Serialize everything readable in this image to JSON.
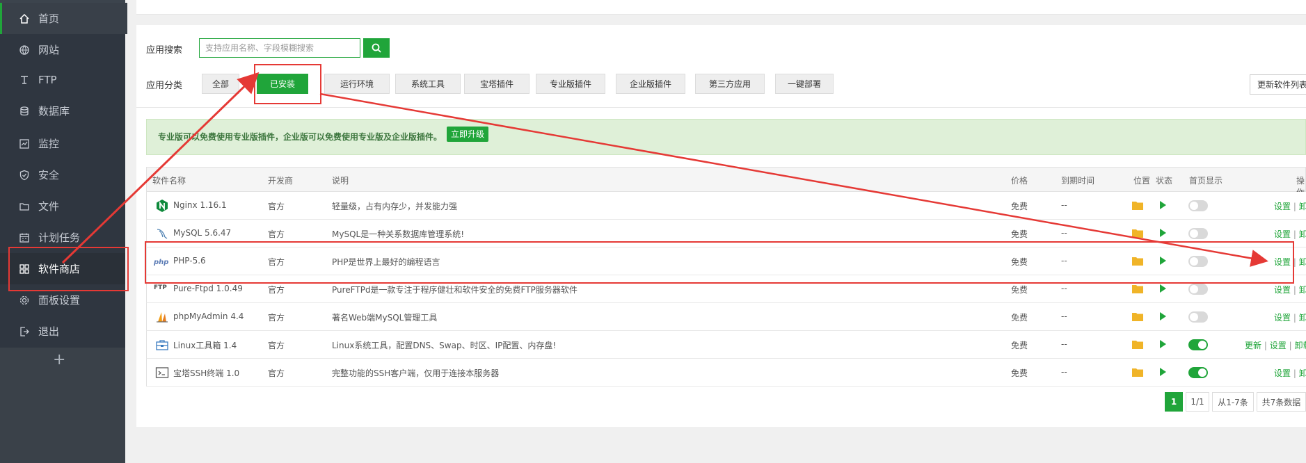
{
  "sidebar": {
    "items": [
      {
        "label": "首页",
        "icon": "home-icon"
      },
      {
        "label": "网站",
        "icon": "globe-icon"
      },
      {
        "label": "FTP",
        "icon": "ftp-icon"
      },
      {
        "label": "数据库",
        "icon": "database-icon"
      },
      {
        "label": "监控",
        "icon": "monitor-icon"
      },
      {
        "label": "安全",
        "icon": "shield-icon"
      },
      {
        "label": "文件",
        "icon": "folder-icon"
      },
      {
        "label": "计划任务",
        "icon": "calendar-icon"
      },
      {
        "label": "软件商店",
        "icon": "grid-icon"
      },
      {
        "label": "面板设置",
        "icon": "gear-icon"
      },
      {
        "label": "退出",
        "icon": "exit-icon"
      }
    ],
    "add_label": "+"
  },
  "search": {
    "label": "应用搜索",
    "placeholder": "支持应用名称、字段模糊搜索"
  },
  "categories": {
    "label": "应用分类",
    "items": [
      "全部",
      "已安装",
      "运行环境",
      "系统工具",
      "宝塔插件",
      "专业版插件",
      "企业版插件",
      "第三方应用",
      "一键部署"
    ],
    "active": "已安装"
  },
  "update_list_label": "更新软件列表",
  "notice": {
    "text": "专业版可以免费使用专业版插件，企业版可以免费使用专业版及企业版插件。",
    "button": "立即升级"
  },
  "table": {
    "headers": {
      "name": "软件名称",
      "dev": "开发商",
      "desc": "说明",
      "price": "价格",
      "expire": "到期时间",
      "location": "位置",
      "status": "状态",
      "home_display": "首页显示",
      "ops": "操作"
    },
    "rows": [
      {
        "name": "Nginx 1.16.1",
        "dev": "官方",
        "desc": "轻量级，占有内存少，并发能力强",
        "price": "免费",
        "expire": "--",
        "home": false,
        "ops": [
          "设置",
          "卸载"
        ],
        "icon": "nginx-icon"
      },
      {
        "name": "MySQL 5.6.47",
        "dev": "官方",
        "desc": "MySQL是一种关系数据库管理系统!",
        "price": "免费",
        "expire": "--",
        "home": false,
        "ops": [
          "设置",
          "卸载"
        ],
        "icon": "mysql-icon"
      },
      {
        "name": "PHP-5.6",
        "dev": "官方",
        "desc": "PHP是世界上最好的编程语言",
        "price": "免费",
        "expire": "--",
        "home": false,
        "ops": [
          "设置",
          "卸载"
        ],
        "icon": "php-icon"
      },
      {
        "name": "Pure-Ftpd 1.0.49",
        "dev": "官方",
        "desc": "PureFTPd是一款专注于程序健壮和软件安全的免费FTP服务器软件",
        "price": "免费",
        "expire": "--",
        "home": false,
        "ops": [
          "设置",
          "卸载"
        ],
        "icon": "ftp-logo-icon"
      },
      {
        "name": "phpMyAdmin 4.4",
        "dev": "官方",
        "desc": "著名Web端MySQL管理工具",
        "price": "免费",
        "expire": "--",
        "home": false,
        "ops": [
          "设置",
          "卸载"
        ],
        "icon": "phpmyadmin-icon"
      },
      {
        "name": "Linux工具箱 1.4",
        "dev": "官方",
        "desc": "Linux系统工具，配置DNS、Swap、时区、IP配置、内存盘!",
        "price": "免费",
        "expire": "--",
        "home": true,
        "ops": [
          "更新",
          "设置",
          "卸载"
        ],
        "icon": "toolbox-icon"
      },
      {
        "name": "宝塔SSH终端 1.0",
        "dev": "官方",
        "desc": "完整功能的SSH客户端，仅用于连接本服务器",
        "price": "免费",
        "expire": "--",
        "home": true,
        "ops": [
          "设置",
          "卸载"
        ],
        "icon": "terminal-icon"
      }
    ]
  },
  "pagination": {
    "current": "1",
    "pages": "1/1",
    "range": "从1-7条",
    "total": "共7条数据"
  },
  "colors": {
    "accent": "#20a53a",
    "sidebar_bg": "#2f3640",
    "annotation": "#e53935"
  }
}
